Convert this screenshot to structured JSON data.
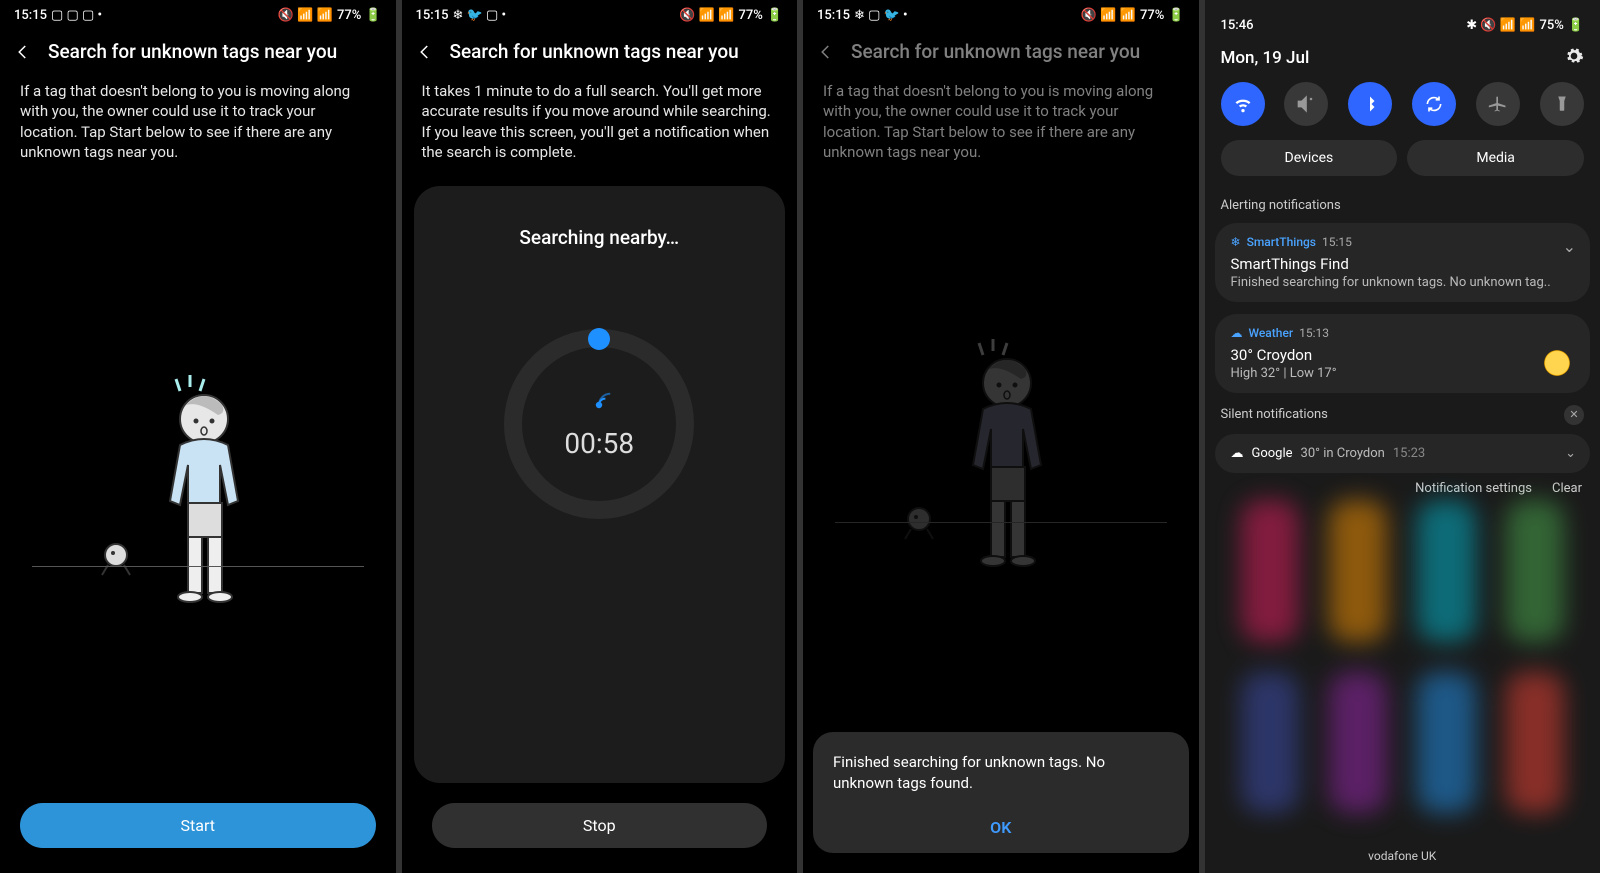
{
  "screens": {
    "s1": {
      "time": "15:15",
      "battery": "77%",
      "title": "Search for unknown tags near you",
      "desc": "If a tag that doesn't belong to you is moving along with you, the owner could use it to track your location. Tap Start below to see if there are any unknown tags near you.",
      "button": "Start"
    },
    "s2": {
      "time": "15:15",
      "battery": "77%",
      "title": "Search for unknown tags near you",
      "desc": "It takes 1 minute to do a full search. You'll get more accurate results if you move around while searching. If you leave this screen, you'll get a notification when the search is complete.",
      "searching": "Searching nearby…",
      "timer": "00:58",
      "button": "Stop"
    },
    "s3": {
      "time": "15:15",
      "battery": "77%",
      "title": "Search for unknown tags near you",
      "desc": "If a tag that doesn't belong to you is moving along with you, the owner could use it to track your location. Tap Start below to see if there are any unknown tags near you.",
      "toast": "Finished searching for unknown tags. No unknown tags found.",
      "ok": "OK"
    },
    "s4": {
      "time": "15:46",
      "battery": "75%",
      "date": "Mon, 19 Jul",
      "devices": "Devices",
      "media": "Media",
      "alerting": "Alerting notifications",
      "st_app": "SmartThings",
      "st_time": "15:15",
      "st_title": "SmartThings Find",
      "st_body": "Finished searching for unknown tags. No unknown tag..",
      "w_app": "Weather",
      "w_time": "15:13",
      "w_title": "30° Croydon",
      "w_body": "High 32° | Low 17°",
      "silent": "Silent notifications",
      "g_app": "Google",
      "g_body": "30° in Croydon",
      "g_time": "15:23",
      "settings": "Notification settings",
      "clear": "Clear",
      "carrier": "vodafone UK"
    }
  }
}
